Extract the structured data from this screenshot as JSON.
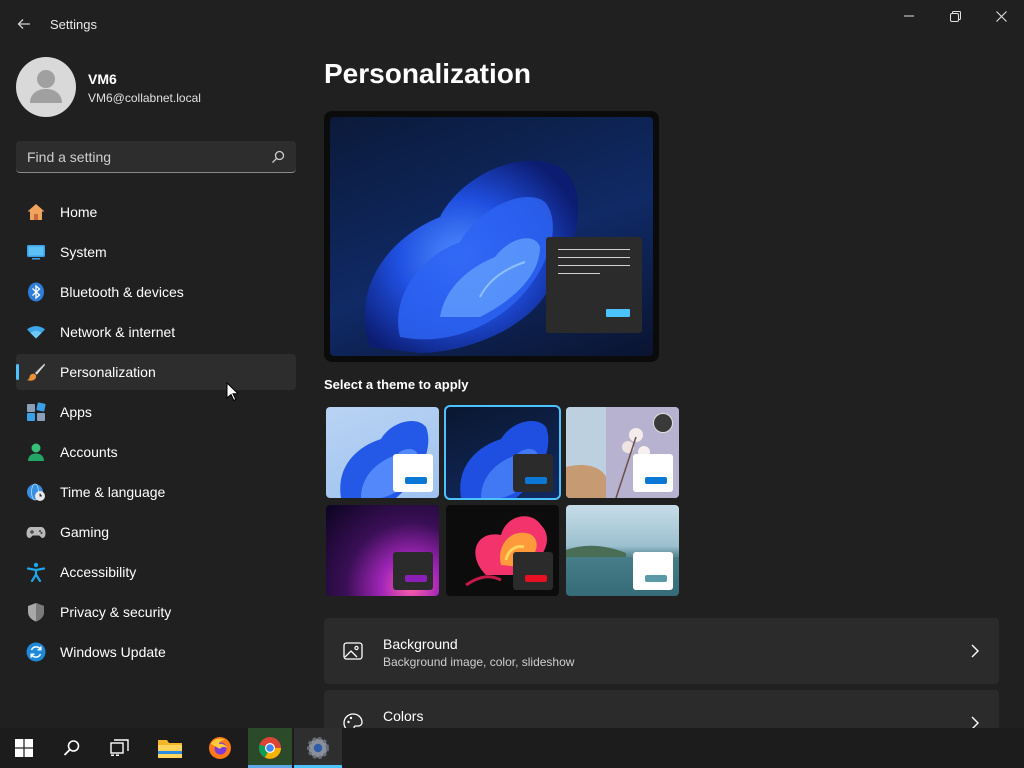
{
  "app": {
    "title": "Settings"
  },
  "profile": {
    "name": "VM6",
    "email": "VM6@collabnet.local"
  },
  "search": {
    "placeholder": "Find a setting"
  },
  "nav": {
    "items": [
      {
        "label": "Home",
        "icon": "home-icon"
      },
      {
        "label": "System",
        "icon": "monitor-icon"
      },
      {
        "label": "Bluetooth & devices",
        "icon": "bluetooth-icon"
      },
      {
        "label": "Network & internet",
        "icon": "wifi-icon"
      },
      {
        "label": "Personalization",
        "icon": "paintbrush-icon",
        "selected": true
      },
      {
        "label": "Apps",
        "icon": "apps-icon"
      },
      {
        "label": "Accounts",
        "icon": "person-icon"
      },
      {
        "label": "Time & language",
        "icon": "globe-clock-icon"
      },
      {
        "label": "Gaming",
        "icon": "gamepad-icon"
      },
      {
        "label": "Accessibility",
        "icon": "accessibility-icon"
      },
      {
        "label": "Privacy & security",
        "icon": "shield-icon"
      },
      {
        "label": "Windows Update",
        "icon": "refresh-icon"
      }
    ]
  },
  "main": {
    "title": "Personalization",
    "themes_label": "Select a theme to apply",
    "themes": [
      {
        "name": "windows-light",
        "selected": false
      },
      {
        "name": "windows-dark",
        "selected": true
      },
      {
        "name": "flowers-spotlight",
        "selected": false
      },
      {
        "name": "glow",
        "selected": false
      },
      {
        "name": "captured-motion",
        "selected": false
      },
      {
        "name": "flow",
        "selected": false
      }
    ],
    "settings": [
      {
        "title": "Background",
        "subtitle": "Background image, color, slideshow",
        "icon": "image-icon"
      },
      {
        "title": "Colors",
        "subtitle": "",
        "icon": "palette-icon"
      }
    ]
  },
  "taskbar": {
    "items": [
      "start-icon",
      "search-icon",
      "task-view-icon",
      "file-explorer-icon",
      "firefox-icon",
      "chrome-icon",
      "settings-icon"
    ]
  },
  "colors": {
    "accent": "#4cc2ff",
    "background": "#202020",
    "card": "#2b2b2b"
  }
}
